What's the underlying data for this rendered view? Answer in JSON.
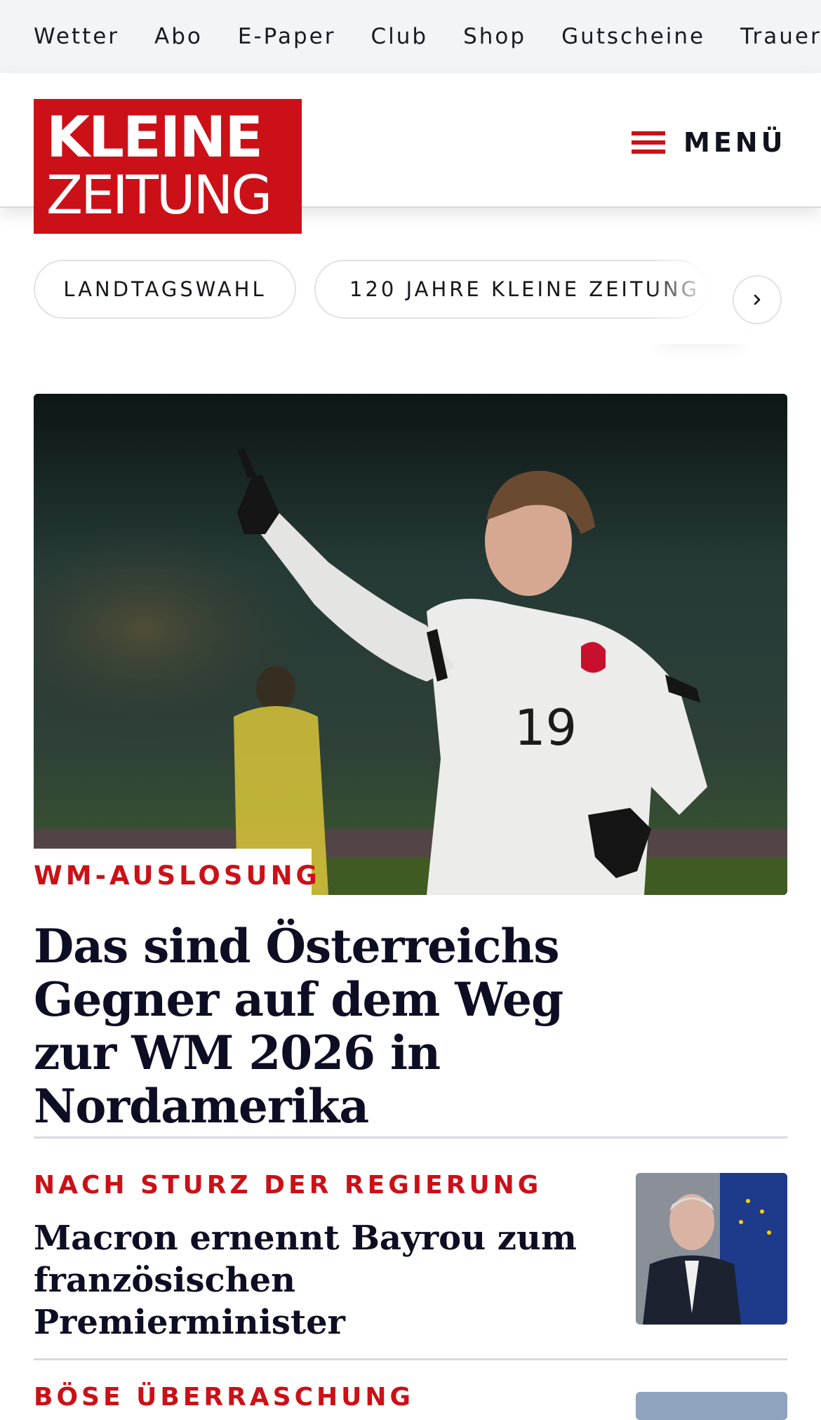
{
  "topnav": {
    "items": [
      "Wetter",
      "Abo",
      "E-Paper",
      "Club",
      "Shop",
      "Gutscheine",
      "Trauerportal"
    ]
  },
  "header": {
    "logo_line1": "KLEINE",
    "logo_line2": "ZEITUNG",
    "menu_label": "MENÜ"
  },
  "topics": {
    "pills": [
      "LANDTAGSWAHL",
      "120 JAHRE KLEINE ZEITUNG"
    ]
  },
  "hero": {
    "kicker": "WM-AUSLOSUNG",
    "title": "Das sind Österreichs Gegner auf dem Weg zur WM 2026 in Nordamerika",
    "jersey_number": "19"
  },
  "articles": [
    {
      "kicker": "NACH STURZ DER REGIERUNG",
      "title": "Macron ernennt Bayrou zum französischen Premierminister"
    },
    {
      "kicker": "BÖSE ÜBERRASCHUNG"
    }
  ],
  "colors": {
    "brand_red": "#cc1017",
    "text_dark": "#0d0d24",
    "nav_bg": "#f3f4f6"
  }
}
